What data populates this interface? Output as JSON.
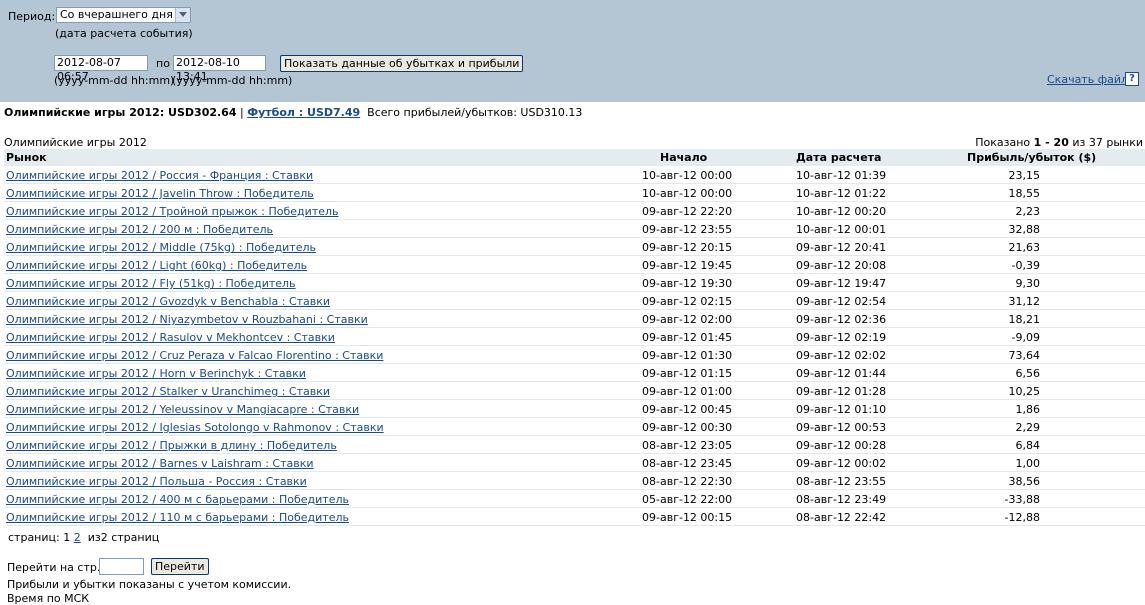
{
  "filter": {
    "period_label": "Период:",
    "period_value": "Со вчерашнего дня",
    "period_hint": "(дата расчета события)",
    "from_value": "2012-08-07 06:57",
    "to_label": "по",
    "to_value": "2012-08-10 13:41",
    "show_button": "Показать данные об убытках и прибыли",
    "format_hint_from": "(yyyy-mm-dd hh:mm)",
    "format_hint_to": "(yyyy-mm-dd hh:mm)",
    "download_link": "Скачать файл",
    "help_icon": "?"
  },
  "summary": {
    "olympics": "Олимпийские игры 2012: USD302.64",
    "separator": "|",
    "football_link": "Футбол : USD7.49",
    "total": "Всего прибылей/убытков:  USD310.13"
  },
  "table": {
    "title": "Олимпийские игры 2012",
    "shown_prefix": "Показано ",
    "shown_range": "1 - 20",
    "shown_suffix": " из 37 рынки",
    "columns": [
      "Рынок",
      "Начало",
      "Дата расчета",
      "Прибыль/убыток ($)"
    ],
    "rows": [
      {
        "market": "Олимпийские игры 2012 / Россия - Франция : Ставки",
        "start": "10-авг-12 00:00",
        "settled": "10-авг-12 01:39",
        "pl": "23,15"
      },
      {
        "market": "Олимпийские игры 2012 / Javelin Throw : Победитель",
        "start": "10-авг-12 00:00",
        "settled": "10-авг-12 01:22",
        "pl": "18,55"
      },
      {
        "market": "Олимпийские игры 2012 / Тройной прыжок : Победитель",
        "start": "09-авг-12 22:20",
        "settled": "10-авг-12 00:20",
        "pl": "2,23"
      },
      {
        "market": "Олимпийские игры 2012 / 200 м : Победитель",
        "start": "09-авг-12 23:55",
        "settled": "10-авг-12 00:01",
        "pl": "32,88"
      },
      {
        "market": "Олимпийские игры 2012 / Middle (75kg) : Победитель",
        "start": "09-авг-12 20:15",
        "settled": "09-авг-12 20:41",
        "pl": "21,63"
      },
      {
        "market": "Олимпийские игры 2012 / Light (60kg) : Победитель",
        "start": "09-авг-12 19:45",
        "settled": "09-авг-12 20:08",
        "pl": "-0,39"
      },
      {
        "market": "Олимпийские игры 2012 / Fly (51kg) : Победитель",
        "start": "09-авг-12 19:30",
        "settled": "09-авг-12 19:47",
        "pl": "9,30"
      },
      {
        "market": "Олимпийские игры 2012 / Gvozdyk v Benchabla : Ставки",
        "start": "09-авг-12 02:15",
        "settled": "09-авг-12 02:54",
        "pl": "31,12"
      },
      {
        "market": "Олимпийские игры 2012 / Niyazymbetov v Rouzbahani : Ставки",
        "start": "09-авг-12 02:00",
        "settled": "09-авг-12 02:36",
        "pl": "18,21"
      },
      {
        "market": "Олимпийские игры 2012 / Rasulov v Mekhontcev : Ставки",
        "start": "09-авг-12 01:45",
        "settled": "09-авг-12 02:19",
        "pl": "-9,09"
      },
      {
        "market": "Олимпийские игры 2012 / Cruz Peraza v Falcao Florentino : Ставки",
        "start": "09-авг-12 01:30",
        "settled": "09-авг-12 02:02",
        "pl": "73,64"
      },
      {
        "market": "Олимпийские игры 2012 / Horn v Berinchyk : Ставки",
        "start": "09-авг-12 01:15",
        "settled": "09-авг-12 01:44",
        "pl": "6,56"
      },
      {
        "market": "Олимпийские игры 2012 / Stalker v Uranchimeg : Ставки",
        "start": "09-авг-12 01:00",
        "settled": "09-авг-12 01:28",
        "pl": "10,25"
      },
      {
        "market": "Олимпийские игры 2012 / Yeleussinov v Mangiacapre : Ставки",
        "start": "09-авг-12 00:45",
        "settled": "09-авг-12 01:10",
        "pl": "1,86"
      },
      {
        "market": "Олимпийские игры 2012 / Iglesias Sotolongo v Rahmonov : Ставки",
        "start": "09-авг-12 00:30",
        "settled": "09-авг-12 00:53",
        "pl": "2,29"
      },
      {
        "market": "Олимпийские игры 2012 / Прыжки в длину : Победитель",
        "start": "08-авг-12 23:05",
        "settled": "09-авг-12 00:28",
        "pl": "6,84"
      },
      {
        "market": "Олимпийские игры 2012 / Barnes v Laishram : Ставки",
        "start": "08-авг-12 23:45",
        "settled": "09-авг-12 00:02",
        "pl": "1,00"
      },
      {
        "market": "Олимпийские игры 2012 / Польша - Россия : Ставки",
        "start": "08-авг-12 22:30",
        "settled": "08-авг-12 23:55",
        "pl": "38,56"
      },
      {
        "market": "Олимпийские игры 2012 / 400 м с барьерами : Победитель",
        "start": "05-авг-12 22:00",
        "settled": "08-авг-12 23:49",
        "pl": "-33,88"
      },
      {
        "market": "Олимпийские игры 2012 / 110 м с барьерами : Победитель",
        "start": "09-авг-12 00:15",
        "settled": "08-авг-12 22:42",
        "pl": "-12,88"
      }
    ]
  },
  "pager": {
    "pages_label": "страниц:",
    "current_page": "1",
    "next_page": "2",
    "of_pages": "из2 страниц",
    "goto_label": "Перейти на стр.:",
    "goto_button": "Перейти",
    "commission_note": "Прибыли и убытки показаны с учетом комиссии.",
    "time_note": "Время по МСК"
  }
}
